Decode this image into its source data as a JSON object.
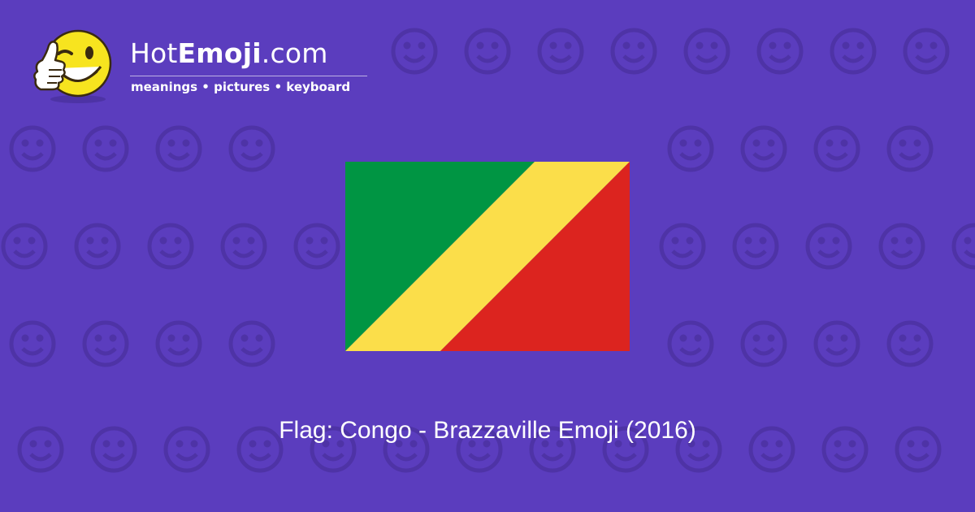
{
  "page": {
    "background_color": "#5b3dbe",
    "background_pattern_color": "#4e33a6"
  },
  "logo": {
    "brand_prefix": "Hot",
    "brand_bold": "Emoji",
    "brand_suffix": ".com",
    "tagline": "meanings • pictures • keyboard",
    "mascot_icon": "winking-thumbs-up-smiley-icon",
    "mascot_color": "#f7e41f",
    "text_color": "#ffffff"
  },
  "flag": {
    "name": "Congo - Brazzaville",
    "icon": "flag-congo-brazzaville-icon",
    "colors": {
      "green": "#009543",
      "yellow": "#fbde4a",
      "red": "#dc241f"
    }
  },
  "caption": {
    "text": "Flag: Congo - Brazzaville Emoji (2016)"
  },
  "background_icons": [
    "smiling-face-icon",
    "winking-face-icon",
    "smiling-face-icon",
    "kissing-face-icon",
    "two-hearts-icon",
    "smiling-face-icon",
    "weary-face-icon",
    "ok-hand-icon",
    "expressionless-face-icon",
    "eyes-icon",
    "smirking-face-icon",
    "relieved-face-icon",
    "exploding-head-icon",
    "recycle-icon",
    "raising-hands-icon",
    "musical-notes-icon",
    "see-no-evil-monkey-icon",
    "victory-hand-icon",
    "sleeping-face-icon",
    "sad-face-icon",
    "grinning-face-icon",
    "sparkles-icon",
    "grinning-face-icon",
    "striped-heart-icon",
    "broken-heart-icon",
    "confused-face-icon",
    "striped-heart-icon",
    "tongue-winking-face-icon",
    "worried-face-icon",
    "heart-with-arrow-icon",
    "tired-face-icon",
    "revolving-hearts-icon",
    "heart-icon",
    "monkey-icon",
    "astonished-face-icon",
    "smiling-devil-icon",
    "angry-face-icon",
    "left-arrow-icon",
    "fire-icon",
    "frowning-face-icon",
    "confetti-icon",
    "squinting-tongue-face-icon",
    "rose-icon",
    "sun-icon",
    "flexed-biceps-icon",
    "striped-heart-icon",
    "check-mark-icon",
    "laughing-face-icon",
    "dark-face-icon",
    "heart-eyes-cat-icon",
    "waving-hand-icon",
    "grimacing-face-icon",
    "camera-icon",
    "sad-face-icon",
    "striped-heart-icon",
    "beaming-face-icon",
    "sparkling-heart-icon",
    "kissing-face-icon",
    "smiling-face-icon"
  ]
}
